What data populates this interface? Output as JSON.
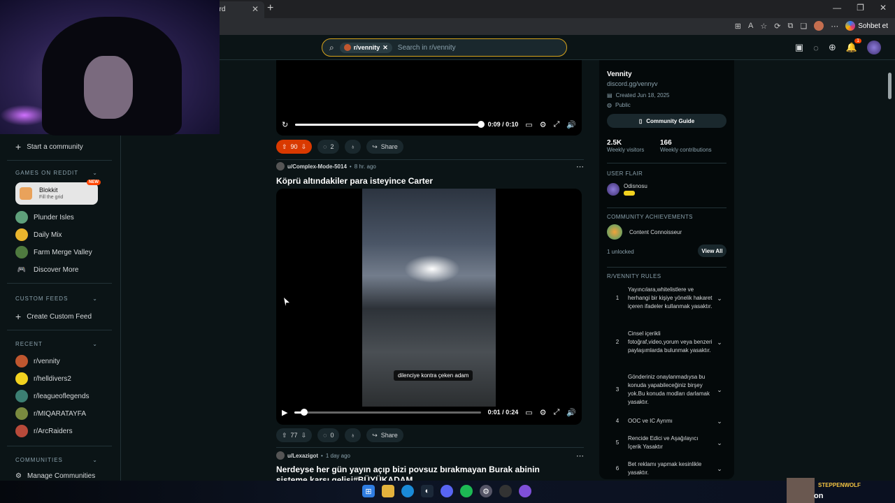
{
  "browser": {
    "tab_title": "ard",
    "copilot_label": "Sohbet et"
  },
  "header": {
    "search_chip": "r/vennity",
    "search_placeholder": "Search in r/vennity",
    "notif_count": "1"
  },
  "sidebar": {
    "start_community": "Start a community",
    "games_heading": "GAMES ON REDDIT",
    "blokkit_title": "Blokkit",
    "blokkit_sub": "Fill the grid",
    "new_badge": "NEW",
    "games": [
      "Plunder Isles",
      "Daily Mix",
      "Farm Merge Valley",
      "Discover More"
    ],
    "custom_heading": "CUSTOM FEEDS",
    "create_feed": "Create Custom Feed",
    "recent_heading": "RECENT",
    "recent": [
      "r/vennity",
      "r/helldivers2",
      "r/leagueoflegends",
      "r/MIQARATAYFA",
      "r/ArcRaiders"
    ],
    "communities_heading": "COMMUNITIES",
    "manage": "Manage Communities"
  },
  "posts": {
    "p1": {
      "time": "0:09 / 0:10",
      "votes": "90",
      "comments": "2",
      "share": "Share",
      "progress": 1.0
    },
    "p2": {
      "user": "u/Complex-Mode-5014",
      "age": "8 hr. ago",
      "title": "Köprü altındakiler para isteyince Carter",
      "caption": "dilenciye kontra çeken adam",
      "time": "0:01 / 0:24",
      "votes": "77",
      "comments": "0",
      "share": "Share",
      "progress": 0.05
    },
    "p3": {
      "user": "u/Lexazigot",
      "age": "1 day ago",
      "title": "Nerdeyse her gün yayın açıp bizi povsuz bırakmayan Burak abinin sisteme karşı gelişi#BÜYÜKADAM"
    }
  },
  "right": {
    "name": "Vennity",
    "link": "discord.gg/vennyv",
    "created": "Created Jun 18, 2025",
    "visibility": "Public",
    "guide": "Community Guide",
    "visitors_n": "2.5K",
    "visitors_l": "Weekly visitors",
    "contrib_n": "166",
    "contrib_l": "Weekly contributions",
    "flair_heading": "USER FLAIR",
    "flair_user": "Odisnosu",
    "ach_heading": "COMMUNITY ACHIEVEMENTS",
    "ach_name": "Content Connoisseur",
    "ach_unlocked": "1 unlocked",
    "view_all": "View All",
    "rules_heading": "R/VENNITY RULES",
    "rules": [
      "Yayıncılara,whitelistlere ve herhangi bir kişiye yönelik hakaret içeren ifadeler kullanmak yasaktır.",
      "Cinsel içerikli fotoğraf,video,yorum veya benzeri paylaşımlarda bulunmak yasaktır.",
      "Gönderiniz onaylanmadıysa bu konuda yapabileceğiniz birşey yok.Bu konuda modları darlamak yasaktır.",
      "OOC ve IC Ayrımı",
      "Rencide Edici ve Aşağılayıcı İçerik Yasaktır",
      "Bet reklamı yapmak kesinlikle yasaktır."
    ]
  },
  "stream": {
    "name": "STEPPENWOLF",
    "sub": "on"
  }
}
